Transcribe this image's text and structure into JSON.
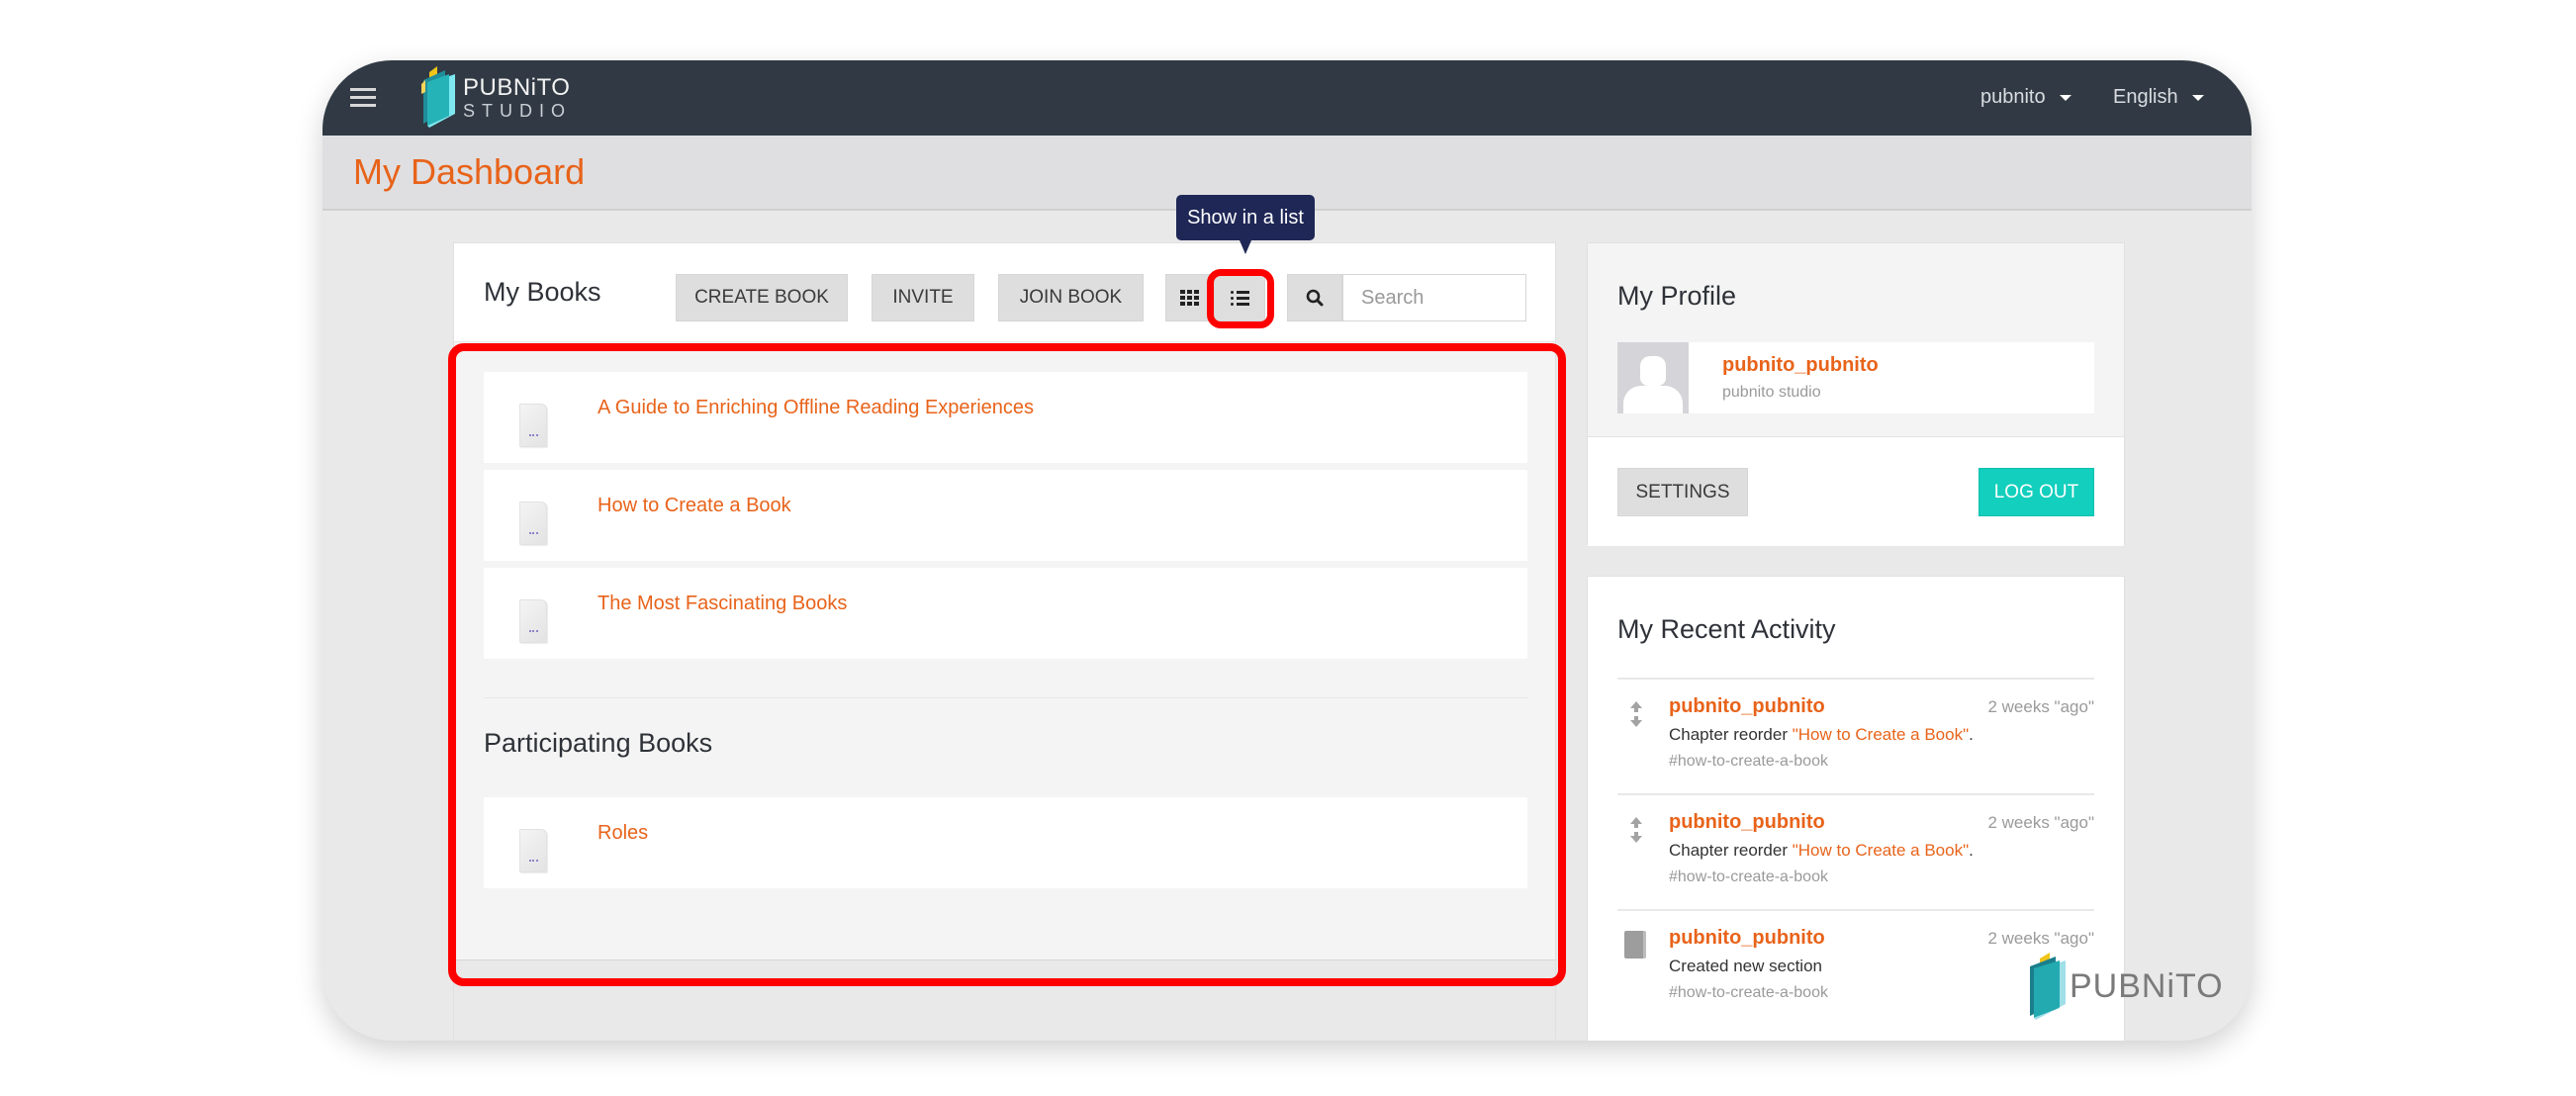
{
  "header": {
    "menu_icon": "hamburger-icon",
    "logo": {
      "line1": "PUBNiTO",
      "line2": "STUDIO",
      "icon": "book-logo-icon"
    },
    "user_menu": {
      "label": "pubnito",
      "icon": "caret-down-icon"
    },
    "language_menu": {
      "label": "English",
      "icon": "caret-down-icon"
    }
  },
  "page": {
    "title": "My Dashboard"
  },
  "my_books": {
    "title": "My Books",
    "buttons": {
      "create": "CREATE BOOK",
      "invite": "INVITE",
      "join": "JOIN BOOK",
      "grid_view_icon": "grid-icon",
      "list_view_icon": "list-icon",
      "search_icon": "search-icon"
    },
    "search": {
      "placeholder": "Search",
      "value": ""
    },
    "tooltip": "Show in a list",
    "books": [
      {
        "title": "A Guide to Enriching Offline Reading Experiences"
      },
      {
        "title": "How to Create a Book"
      },
      {
        "title": "The Most Fascinating Books"
      }
    ]
  },
  "participating_books": {
    "title": "Participating Books",
    "books": [
      {
        "title": "Roles"
      }
    ]
  },
  "profile": {
    "title": "My Profile",
    "username": "pubnito_pubnito",
    "subtitle": "pubnito studio",
    "settings_label": "SETTINGS",
    "logout_label": "LOG OUT"
  },
  "activity": {
    "title": "My Recent Activity",
    "items": [
      {
        "icon": "reorder-icon",
        "user": "pubnito_pubnito",
        "time": "2 weeks \"ago\"",
        "action": "Chapter reorder ",
        "link": "\"How to Create a Book\"",
        "suffix": ".",
        "tag": "#how-to-create-a-book"
      },
      {
        "icon": "reorder-icon",
        "user": "pubnito_pubnito",
        "time": "2 weeks \"ago\"",
        "action": "Chapter reorder ",
        "link": "\"How to Create a Book\"",
        "suffix": ".",
        "tag": "#how-to-create-a-book"
      },
      {
        "icon": "document-icon",
        "user": "pubnito_pubnito",
        "time": "2 weeks \"ago\"",
        "action": "Created new section",
        "link": "",
        "suffix": "",
        "tag": "#how-to-create-a-book"
      }
    ]
  },
  "watermark": {
    "text": "PUBNiTO"
  },
  "colors": {
    "brand_orange": "#e8631a",
    "topbar": "#313a44",
    "tooltip_bg": "#1f2756",
    "logout_teal": "#13cfbd",
    "highlight_red": "#ff0000"
  }
}
